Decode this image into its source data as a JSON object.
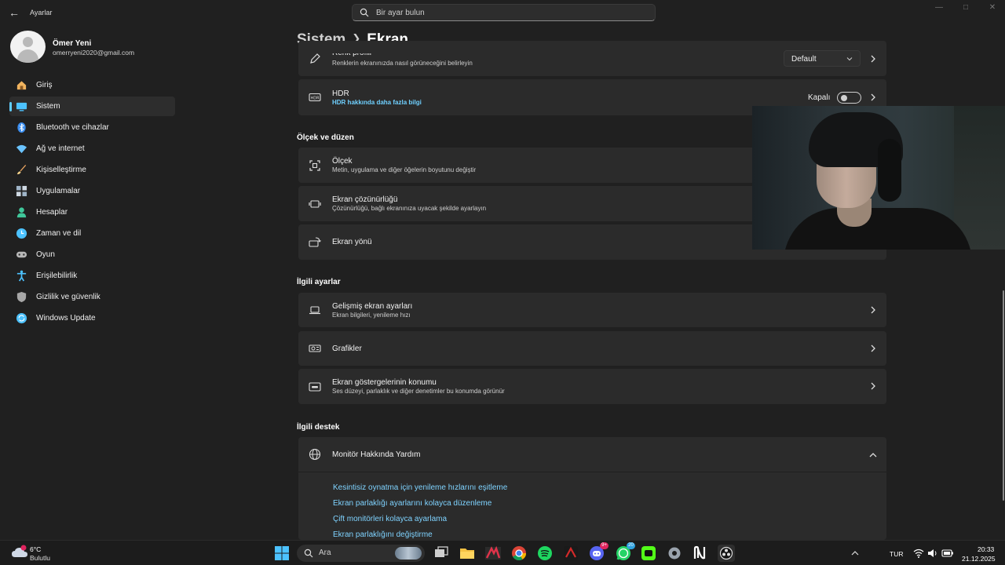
{
  "titlebar": {
    "app_title": "Ayarlar"
  },
  "search": {
    "placeholder": "Bir ayar bulun"
  },
  "profile": {
    "name": "Ömer Yeni",
    "email": "omerryeni2020@gmail.com"
  },
  "sidebar": {
    "items": [
      {
        "label": "Giriş",
        "icon": "home-icon",
        "color": "#f0b35e"
      },
      {
        "label": "Sistem",
        "icon": "system-icon",
        "color": "#4cc2ff",
        "active": true
      },
      {
        "label": "Bluetooth ve cihazlar",
        "icon": "bluetooth-icon",
        "color": "#3b8ef0"
      },
      {
        "label": "Ağ ve internet",
        "icon": "wifi-icon",
        "color": "#6ac3ff"
      },
      {
        "label": "Kişiselleştirme",
        "icon": "brush-icon",
        "color": "#e9a460"
      },
      {
        "label": "Uygulamalar",
        "icon": "apps-icon",
        "color": "#9fb4c8"
      },
      {
        "label": "Hesaplar",
        "icon": "accounts-icon",
        "color": "#3fc79a"
      },
      {
        "label": "Zaman ve dil",
        "icon": "clock-globe-icon",
        "color": "#4cc2ff"
      },
      {
        "label": "Oyun",
        "icon": "gamepad-icon",
        "color": "#b8b8b8"
      },
      {
        "label": "Erişilebilirlik",
        "icon": "accessibility-icon",
        "color": "#4cc2ff"
      },
      {
        "label": "Gizlilik ve güvenlik",
        "icon": "shield-icon",
        "color": "#a7a7a7"
      },
      {
        "label": "Windows Update",
        "icon": "update-icon",
        "color": "#4cc2ff"
      }
    ]
  },
  "breadcrumb": {
    "parent": "Sistem",
    "current": "Ekran"
  },
  "color_profile": {
    "title": "Renk profili",
    "subtitle": "Renklerin ekranınızda nasıl görüneceğini belirleyin",
    "value": "Default"
  },
  "hdr": {
    "title": "HDR",
    "link": "HDR hakkında daha fazla bilgi",
    "state": "Kapalı"
  },
  "scale_section": {
    "title": "Ölçek ve düzen",
    "items": [
      {
        "title": "Ölçek",
        "subtitle": "Metin, uygulama ve diğer öğelerin boyutunu değiştir"
      },
      {
        "title": "Ekran çözünürlüğü",
        "subtitle": "Çözünürlüğü, bağlı ekranınıza uyacak şekilde ayarlayın"
      },
      {
        "title": "Ekran yönü",
        "subtitle": ""
      }
    ]
  },
  "related_section": {
    "title": "İlgili ayarlar",
    "items": [
      {
        "title": "Gelişmiş ekran ayarları",
        "subtitle": "Ekran bilgileri, yenileme hızı"
      },
      {
        "title": "Grafikler",
        "subtitle": ""
      },
      {
        "title": "Ekran göstergelerinin konumu",
        "subtitle": "Ses düzeyi, parlaklık ve diğer denetimler bu konumda görünür"
      }
    ]
  },
  "support_section": {
    "title": "İlgili destek",
    "help_title": "Monitör Hakkında Yardım",
    "links": [
      "Kesintisiz oynatma için yenileme hızlarını eşitleme",
      "Ekran parlaklığı ayarlarını kolayca düzenleme",
      "Çift monitörleri kolayca ayarlama",
      "Ekran parlaklığını değiştirme"
    ]
  },
  "taskbar": {
    "weather": {
      "temp": "6°C",
      "desc": "Bulutlu",
      "badge": "1"
    },
    "search_label": "Ara",
    "discord_badge": "9+",
    "whatsapp_badge": "20",
    "lang": "TUR",
    "time": "20:33",
    "date": "21.12.2025"
  }
}
